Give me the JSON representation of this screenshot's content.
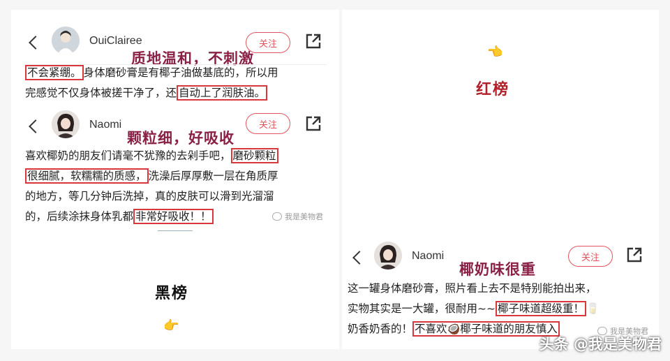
{
  "left_panel": {
    "post1": {
      "username": "OuiClairee",
      "follow_label": "关注",
      "caption": "质地温和，不刺激",
      "line1_hl": "不会紧绷。",
      "line1_rest": "身体磨砂膏是有椰子油做基底的，所以用",
      "line2_pre": "完感觉不仅身体被搓干净了，还",
      "line2_hl": "自动上了润肤油。"
    },
    "post2": {
      "username": "Naomi",
      "follow_label": "关注",
      "caption": "颗粒细，好吸收",
      "line1_pre": "喜欢椰奶的朋友们请毫不犹豫的去剁手吧，",
      "line1_hl": "磨砂颗粒",
      "line2_hl": "很细腻，软糯糯的质感，",
      "line2_rest": "洗澡后厚厚敷一层在角质厚",
      "line3": "的地方，等几分钟后洗掉，真的皮肤可以滑到光溜溜",
      "line4_pre": "的，后续涂抹身体乳都",
      "line4_hl": "非常好吸收！！",
      "watermark": "我是美物君"
    },
    "black_label": "黑榜",
    "pointer": "👉"
  },
  "right_panel": {
    "pointer": "👈",
    "red_label": "红榜",
    "post3": {
      "username": "Naomi",
      "follow_label": "关注",
      "caption": "椰奶味很重",
      "line1": "这一罐身体磨砂膏，照片看上去不是特别能拍出来，",
      "line2_pre": "实物其实是一大罐，很耐用~~",
      "line2_hl": "椰子味道超级重！",
      "line2_emoji": "🥛",
      "line3_pre": "奶香奶香的！",
      "line3_hl_a": "不喜欢",
      "line3_emoji": "🥥",
      "line3_hl_b": "椰子味道的朋友慎入",
      "watermark": "我是美物君"
    }
  },
  "footer_watermark": "头条 @我是美物君",
  "colors": {
    "caption": "#8a2045",
    "highlight_border": "#d8373c",
    "follow": "#e0555e",
    "black_label": "#111111",
    "red_label": "#b2202a"
  }
}
